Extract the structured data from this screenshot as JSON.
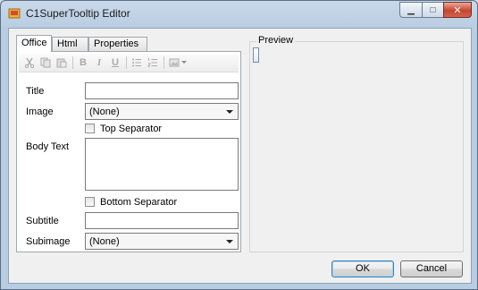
{
  "window": {
    "title": "C1SuperTooltip Editor"
  },
  "titlebar": {
    "minimize_glyph": "▁",
    "maximize_glyph": "□",
    "close_glyph": "✕"
  },
  "tabs": [
    {
      "label": "Office",
      "active": true
    },
    {
      "label": "Html",
      "active": false
    },
    {
      "label": "Properties",
      "active": false
    }
  ],
  "toolbar": {
    "icons": [
      "cut-icon",
      "copy-icon",
      "paste-icon",
      "bold-icon",
      "italic-icon",
      "underline-icon",
      "bulleted-list-icon",
      "numbered-list-icon",
      "image-insert-icon"
    ],
    "bold_glyph": "B",
    "italic_glyph": "I",
    "underline_glyph": "U"
  },
  "form": {
    "title_label": "Title",
    "title_value": "",
    "image_label": "Image",
    "image_value": "(None)",
    "top_separator_label": "Top Separator",
    "body_label": "Body Text",
    "body_value": "",
    "bottom_separator_label": "Bottom Separator",
    "subtitle_label": "Subtitle",
    "subtitle_value": "",
    "subimage_label": "Subimage",
    "subimage_value": "(None)"
  },
  "preview": {
    "label": "Preview"
  },
  "buttons": {
    "ok": "OK",
    "cancel": "Cancel"
  },
  "colors": {
    "accent": "#3c7fb1",
    "close_button": "#c7452e",
    "window_frame": "#b9cde2"
  }
}
